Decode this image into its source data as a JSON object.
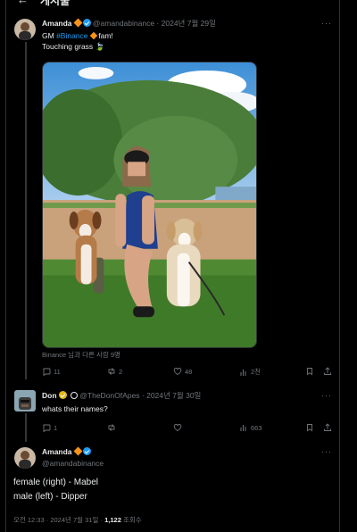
{
  "header": {
    "back_icon": "arrow-left-icon",
    "title": "게시물"
  },
  "post": {
    "name": "Amanda",
    "handle": "@amandabinance",
    "dot": "·",
    "date": "2024년 7월 29일",
    "more": "···",
    "text_prefix": "GM ",
    "hashtag": "#Binance",
    "text_suffix": " fam!",
    "line2": "Touching grass",
    "leaf_emoji": "🍃",
    "caption": "Binance 님과 다른 사람 9명",
    "stats": {
      "replies": "11",
      "reposts": "2",
      "likes": "48",
      "views": "2천"
    }
  },
  "reply": {
    "name": "Don",
    "handle": "@TheDonOfApes",
    "dot": "·",
    "date": "2024년 7월 30일",
    "more": "···",
    "text": "whats their names?",
    "stats": {
      "replies": "1",
      "reposts": "",
      "likes": "",
      "views": "663"
    }
  },
  "focus": {
    "name": "Amanda",
    "handle": "@amandabinance",
    "more": "···",
    "line1": "female (right) - Mabel",
    "line2": "male (left) - Dipper",
    "time": "오전 12:33",
    "dot": "·",
    "date": "2024년 7월 31일",
    "dot2": "·",
    "views_count": "1,122",
    "views_label": "조회수"
  },
  "colors": {
    "accent": "#1d9bf0",
    "verified_gold": "#e2b719",
    "binance": "#f7931a",
    "muted": "#71767b"
  }
}
